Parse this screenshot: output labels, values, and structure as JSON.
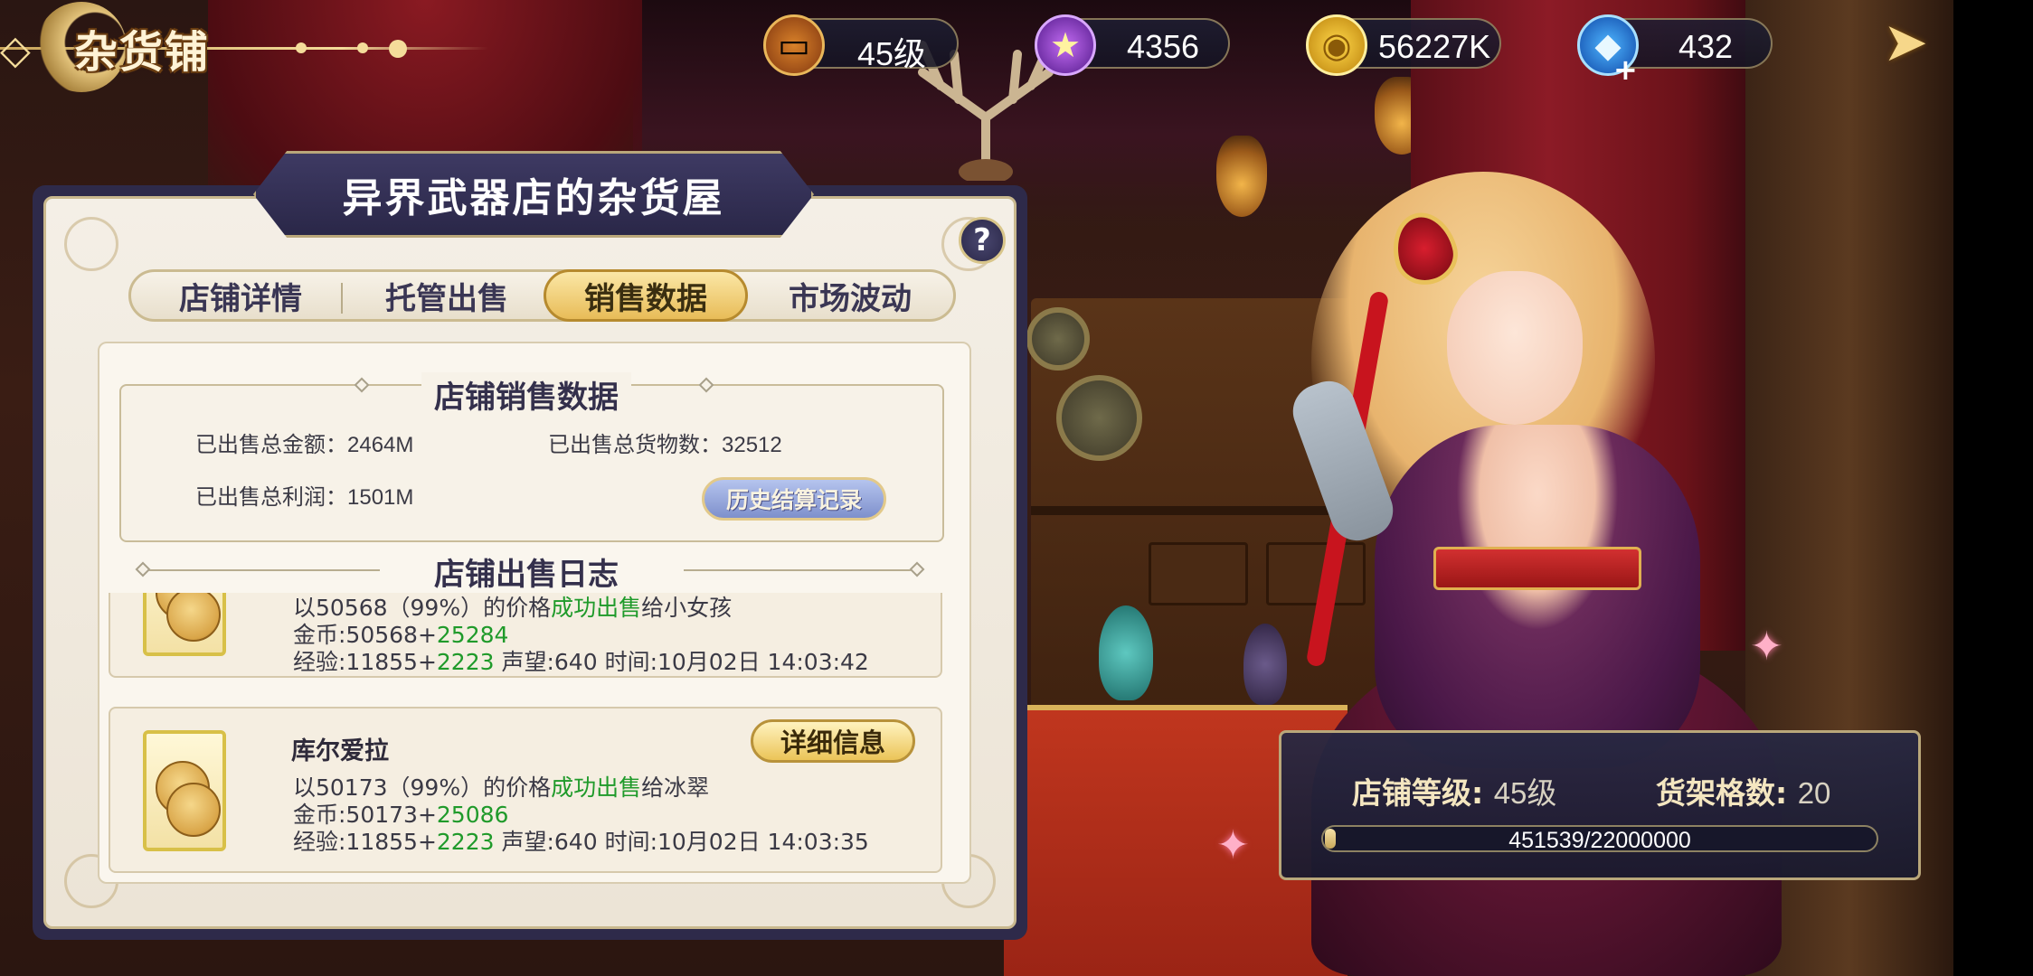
{
  "header": {
    "title": "杂货铺",
    "resources": [
      {
        "icon": "treasure-chest-icon",
        "value": "45级"
      },
      {
        "icon": "purple-star-icon",
        "value": "4356"
      },
      {
        "icon": "gold-coin-icon",
        "value": "56227K"
      },
      {
        "icon": "blue-diamond-icon",
        "value": "432",
        "plus": "+"
      }
    ]
  },
  "panel": {
    "title": "异界武器店的杂货屋",
    "help": "?",
    "tabs": [
      {
        "label": "店铺详情",
        "active": false
      },
      {
        "label": "托管出售",
        "active": false
      },
      {
        "label": "销售数据",
        "active": true
      },
      {
        "label": "市场波动",
        "active": false
      }
    ],
    "sales": {
      "title": "店铺销售数据",
      "total_amount_label": "已出售总金额：",
      "total_amount": "2464M",
      "total_goods_label": "已出售总货物数：",
      "total_goods": "32512",
      "total_profit_label": "已出售总利润：",
      "total_profit": "1501M",
      "history_button": "历史结算记录"
    },
    "log": {
      "title": "店铺出售日志",
      "entries": [
        {
          "name": "",
          "price_prefix": "以50568（99%）的价格",
          "sold": "成功出售",
          "buyer": "给小女孩",
          "coin_prefix": "金币:50568+",
          "coin_gain": "25284",
          "exp_prefix": "经验:11855+",
          "exp_gain": "2223",
          "rest": " 声望:640 时间:10月02日 14:03:42"
        },
        {
          "name": "库尔爱拉",
          "detail_button": "详细信息",
          "price_prefix": "以50173（99%）的价格",
          "sold": "成功出售",
          "buyer": "给冰翠",
          "coin_prefix": "金币:50173+",
          "coin_gain": "25086",
          "exp_prefix": "经验:11855+",
          "exp_gain": "2223",
          "rest": " 声望:640 时间:10月02日 14:03:35"
        }
      ]
    }
  },
  "shop_level": {
    "level_label": "店铺等级:",
    "level_value": "45级",
    "shelf_label": "货架格数:",
    "shelf_value": "20",
    "exp_current": 451539,
    "exp_max": 22000000,
    "exp_text": "451539/22000000"
  },
  "colors": {
    "gain_green": "#1f9a2a",
    "panel_frame": "#2e2a4a",
    "tab_active": "#e8bc58"
  }
}
